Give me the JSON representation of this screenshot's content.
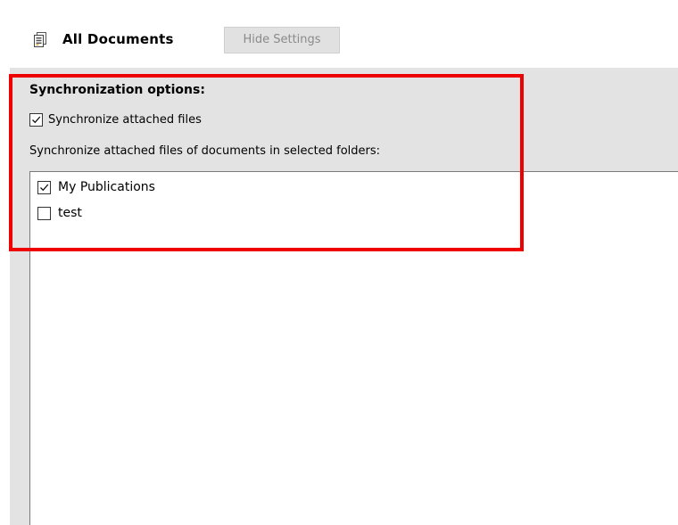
{
  "toolbar": {
    "icon": "documents-icon",
    "title": "All Documents",
    "hide_settings_label": "Hide Settings"
  },
  "sync_options": {
    "heading": "Synchronization options:",
    "sync_attached": {
      "label": "Synchronize attached files",
      "checked": true
    },
    "folders_caption": "Synchronize attached files of documents in selected folders:",
    "folders": [
      {
        "label": "My Publications",
        "checked": true
      },
      {
        "label": "test",
        "checked": false
      }
    ]
  },
  "colors": {
    "highlight": "#ee0000",
    "panel": "#e3e3e3",
    "list": "#ffffff"
  }
}
